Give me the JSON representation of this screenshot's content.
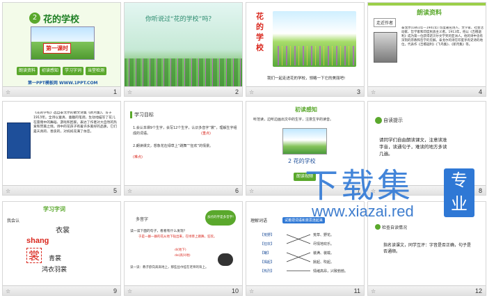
{
  "slides": [
    {
      "num": "1",
      "title": "花的学校",
      "badge": "2",
      "lesson_tag": "第一课时",
      "buttons": [
        "朗读资料",
        "初读感知",
        "学习字词",
        "当堂检测"
      ],
      "footer": "第一PPT模板网 WWW.1PPT.COM"
    },
    {
      "num": "2",
      "question": "你听说过“花的学校”吗？"
    },
    {
      "num": "3",
      "vertical_title": "花的学校",
      "caption": "我们一起走进花的学校，领略一下它的美丽吧!"
    },
    {
      "num": "4",
      "heading": "朗读资料",
      "tag": "走近作者",
      "bio": "泰戈尔(1861年—1941年) 印度著名诗人、文学家、社会活动家、哲学家和印度民族主义者。1913年，他以《吉檀迦利》成为第一位获得诺贝尔文学奖的亚洲人。他的诗中含有深刻的宗教和哲学的见解。泰戈尔的诗在印度享有史诗的地位，代表作《吉檀迦利》《飞鸟集》、《新月集》等。"
    },
    {
      "num": "5",
      "text": "《花的学校》选自泰戈尔的散文诗集《新月集》，写于1913年。全诗以童真、童趣的笔调，生动地描写了花儿在雷雨中的舞蹈、游戏和回家，表达了作者对大自然的热爱和赞美之情。诗中的花孩子有着许多美好的品质，它们是天真的、善良的，对妈妈充满了依恋。"
    },
    {
      "num": "6",
      "heading": "学习目标",
      "goal1": "1.会认本课9个生字，会写12个生字，认识多音字“裳”，理解生字组成的词语。",
      "goal1_tag": "(重点)",
      "goal2": "2.朗读课文，想象花在绿草上“跳舞”“狂欢”的情景。",
      "goal2_tag": "(难点)"
    },
    {
      "num": "7",
      "heading": "初读感知",
      "instruction": "听范读，边听边画出文中的生字，注意生字的读音。",
      "card_label": "2 花的学校",
      "button": "朗读视频"
    },
    {
      "num": "8",
      "tag": "自读提示",
      "hint": "请同学们自由朗读课文，注意读准字音，读通句子，难读的地方多读几遍。"
    },
    {
      "num": "9",
      "heading": "学习字词",
      "tag": "我会认",
      "word": "衣裳",
      "pinyin": "shang",
      "char": "裳",
      "word1": "青裳",
      "word2": "鸿衣羽裳"
    },
    {
      "num": "10",
      "tag": "多音字",
      "bubble": "加点的字是多音字!",
      "q": "读一读下面的句子，看看有什么发现？",
      "s1": "于是一群一群的花从地下钻出来，在绿草上跳舞，狂欢。",
      "p1": "dì(地下)",
      "p2": "de(高兴地)",
      "s2": "读一读：教子欲向高高地上，那些丝巾挂在老师的背上。"
    },
    {
      "num": "11",
      "tag": "理解词语",
      "banner": "试着把词语和意思连起来",
      "left": [
        "【荒野】",
        "【狂欢】",
        "【罐】",
        "【揭起】",
        "【热烈】"
      ],
      "right": [
        "荒草、野花。",
        "尽情地欢乐。",
        "装满、装载。",
        "掀起、吹起。",
        "情绪高昂，兴致勃勃。"
      ]
    },
    {
      "num": "12",
      "tag": "检查自读情况",
      "text": "指名读课文，同学互评：字音是否正确，句子是否通顺。"
    }
  ],
  "watermark": {
    "big": "下载集",
    "url": "www.xiazai.red",
    "badge": "专业"
  },
  "colors": {
    "green": "#5aa82c",
    "red": "#d9261c",
    "blue": "#2f78d5",
    "light_green": "#9ccf4a"
  }
}
